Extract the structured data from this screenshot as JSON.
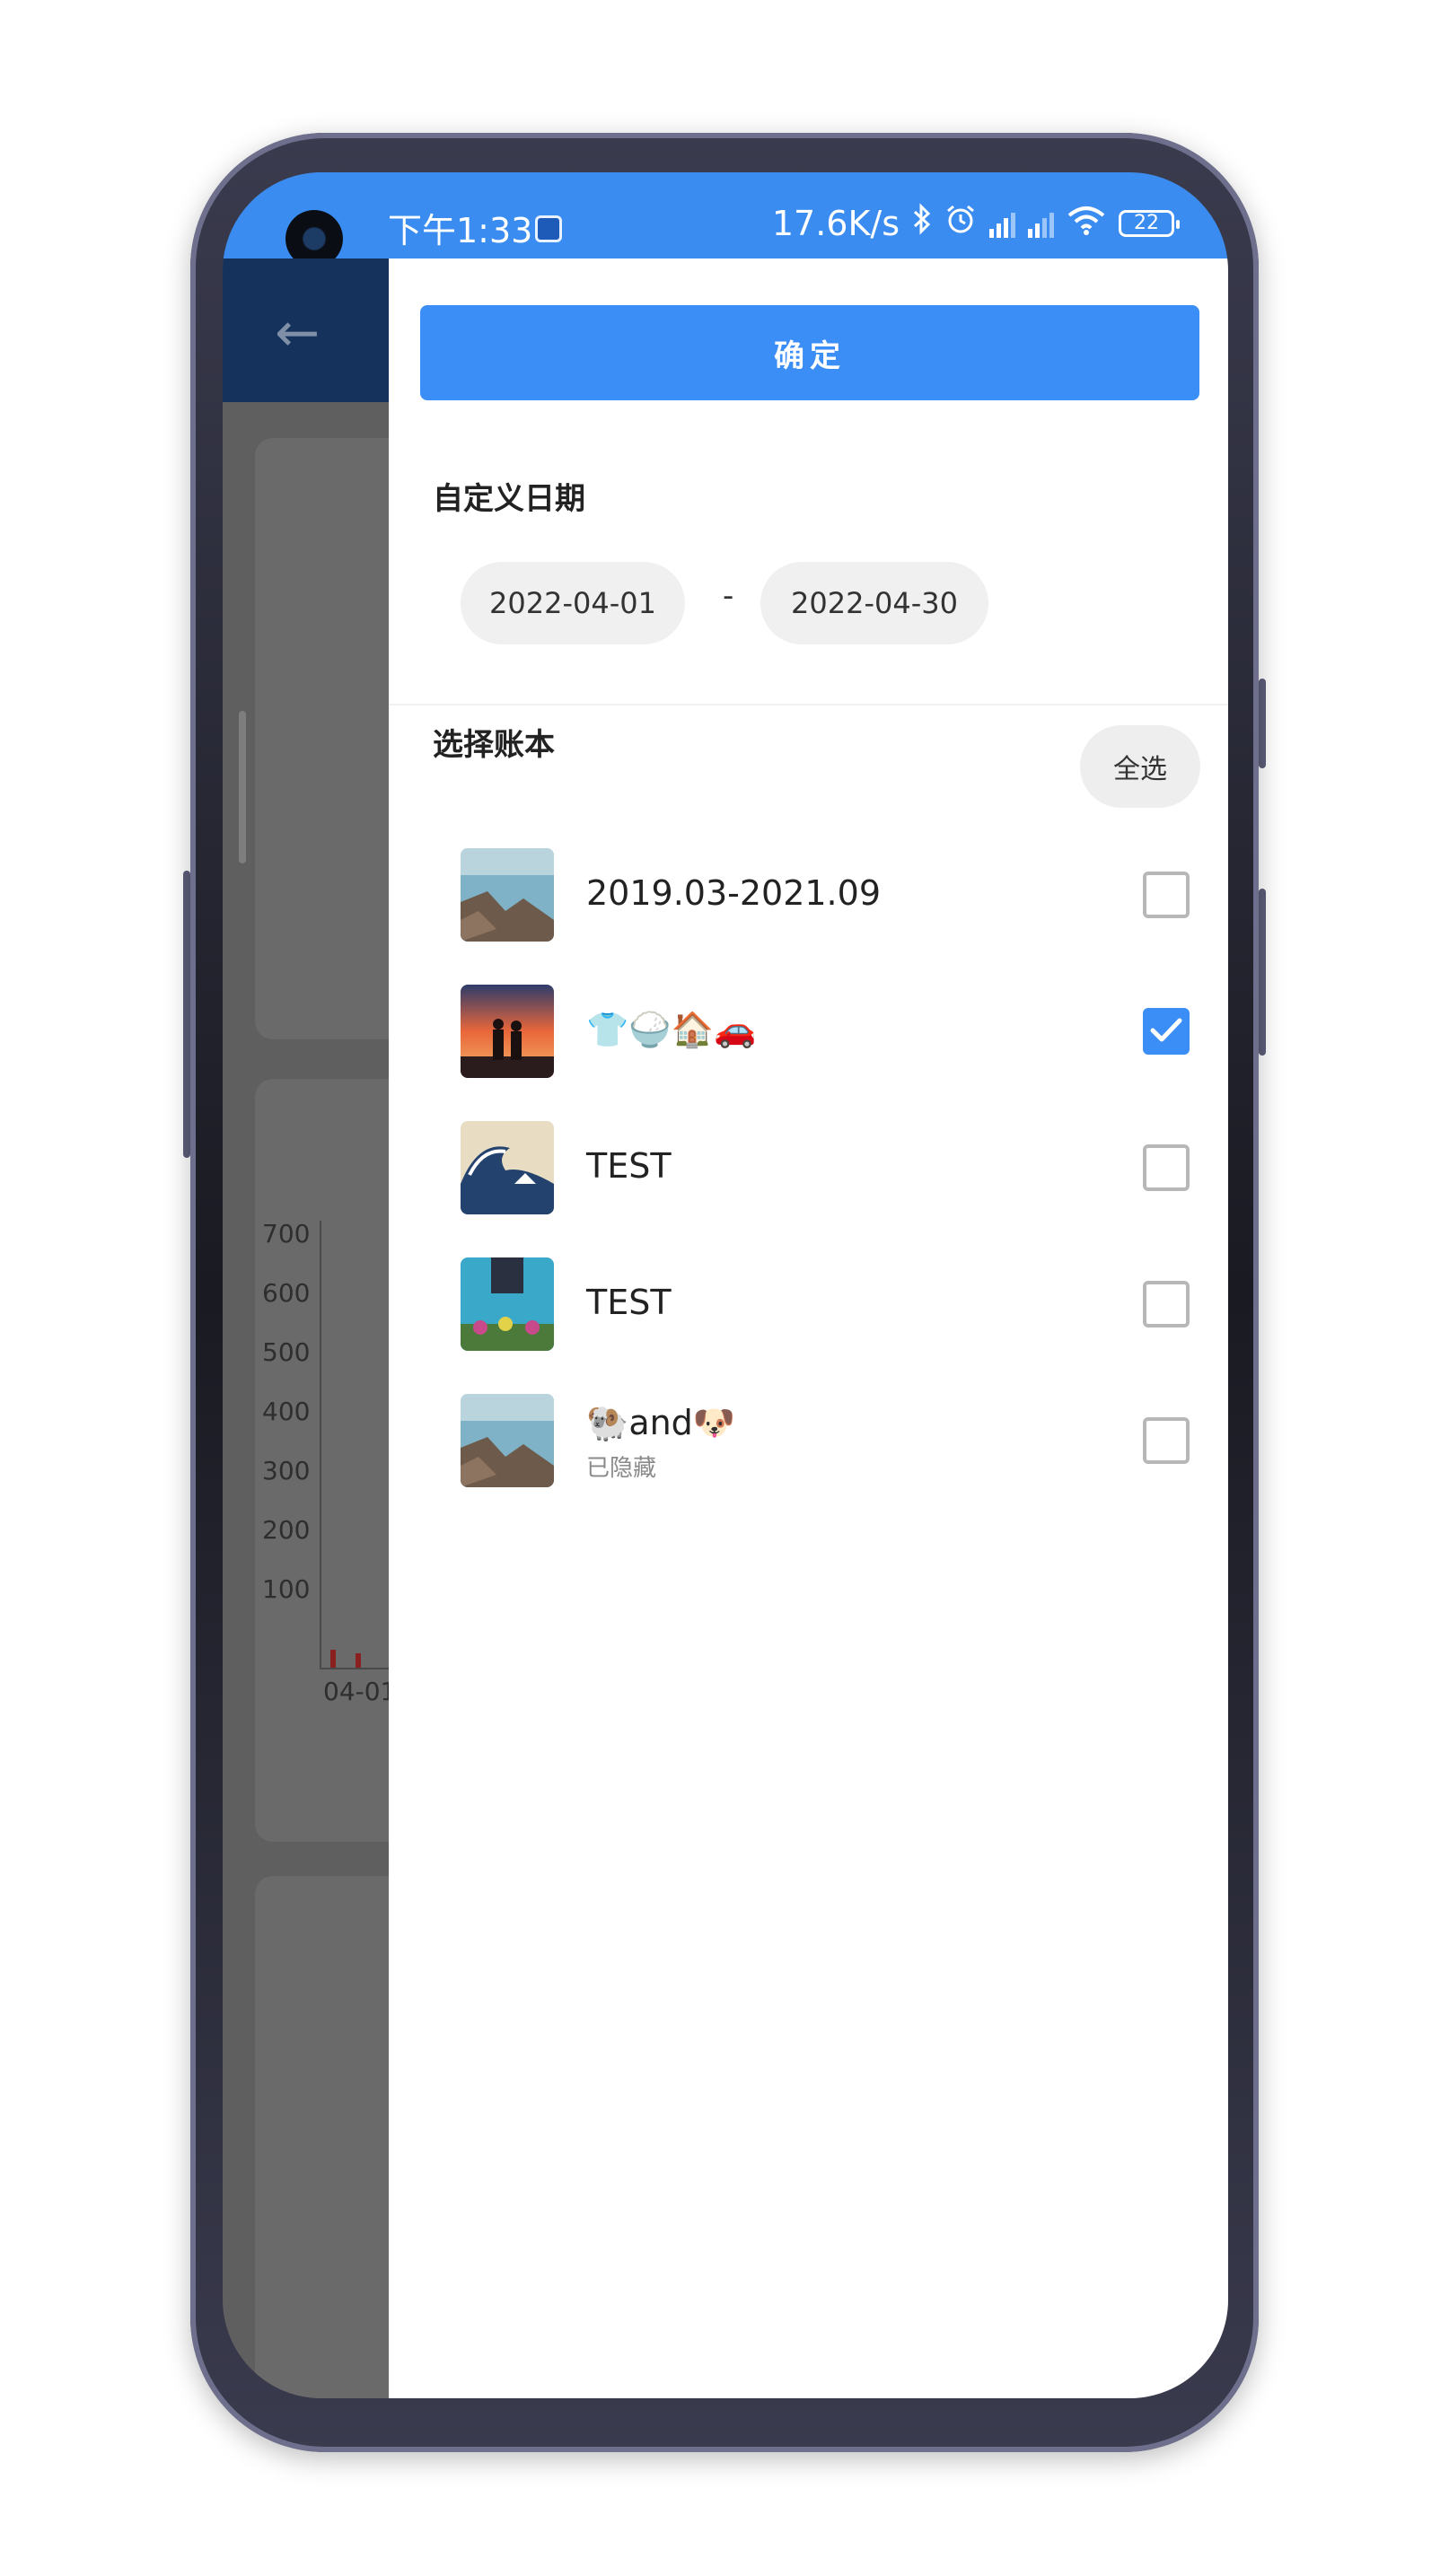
{
  "status_bar": {
    "time": "下午1:33",
    "net_speed": "17.6K/s",
    "battery": "22",
    "icons": [
      "app-notification-icon",
      "bluetooth-icon",
      "alarm-icon",
      "signal-hd-icon",
      "signal-hd-icon",
      "wifi-icon",
      "battery-icon"
    ]
  },
  "background": {
    "back_icon": "←",
    "y_ticks": [
      "700",
      "600",
      "500",
      "400",
      "300",
      "200",
      "100"
    ],
    "x_label": "04-01"
  },
  "drawer": {
    "confirm_label": "确定",
    "custom_date": {
      "title": "自定义日期",
      "start": "2022-04-01",
      "separator": "-",
      "end": "2022-04-30"
    },
    "books": {
      "title": "选择账本",
      "select_all_label": "全选",
      "items": [
        {
          "name": "2019.03-2021.09",
          "subtitle": "",
          "checked": false,
          "thumbnail": "coast-rocks"
        },
        {
          "name": "👕🍚🏠🚗",
          "subtitle": "",
          "checked": true,
          "thumbnail": "sunset-couple"
        },
        {
          "name": "TEST",
          "subtitle": "",
          "checked": false,
          "thumbnail": "great-wave"
        },
        {
          "name": "TEST",
          "subtitle": "",
          "checked": false,
          "thumbnail": "blue-wall-flowers"
        },
        {
          "name": "🐏and🐶",
          "subtitle": "已隐藏",
          "checked": false,
          "thumbnail": "coast-rocks"
        }
      ]
    }
  },
  "colors": {
    "accent": "#3a8ef5",
    "status_bar": "#3a8cf1",
    "overlay": "#5f5f5f"
  }
}
